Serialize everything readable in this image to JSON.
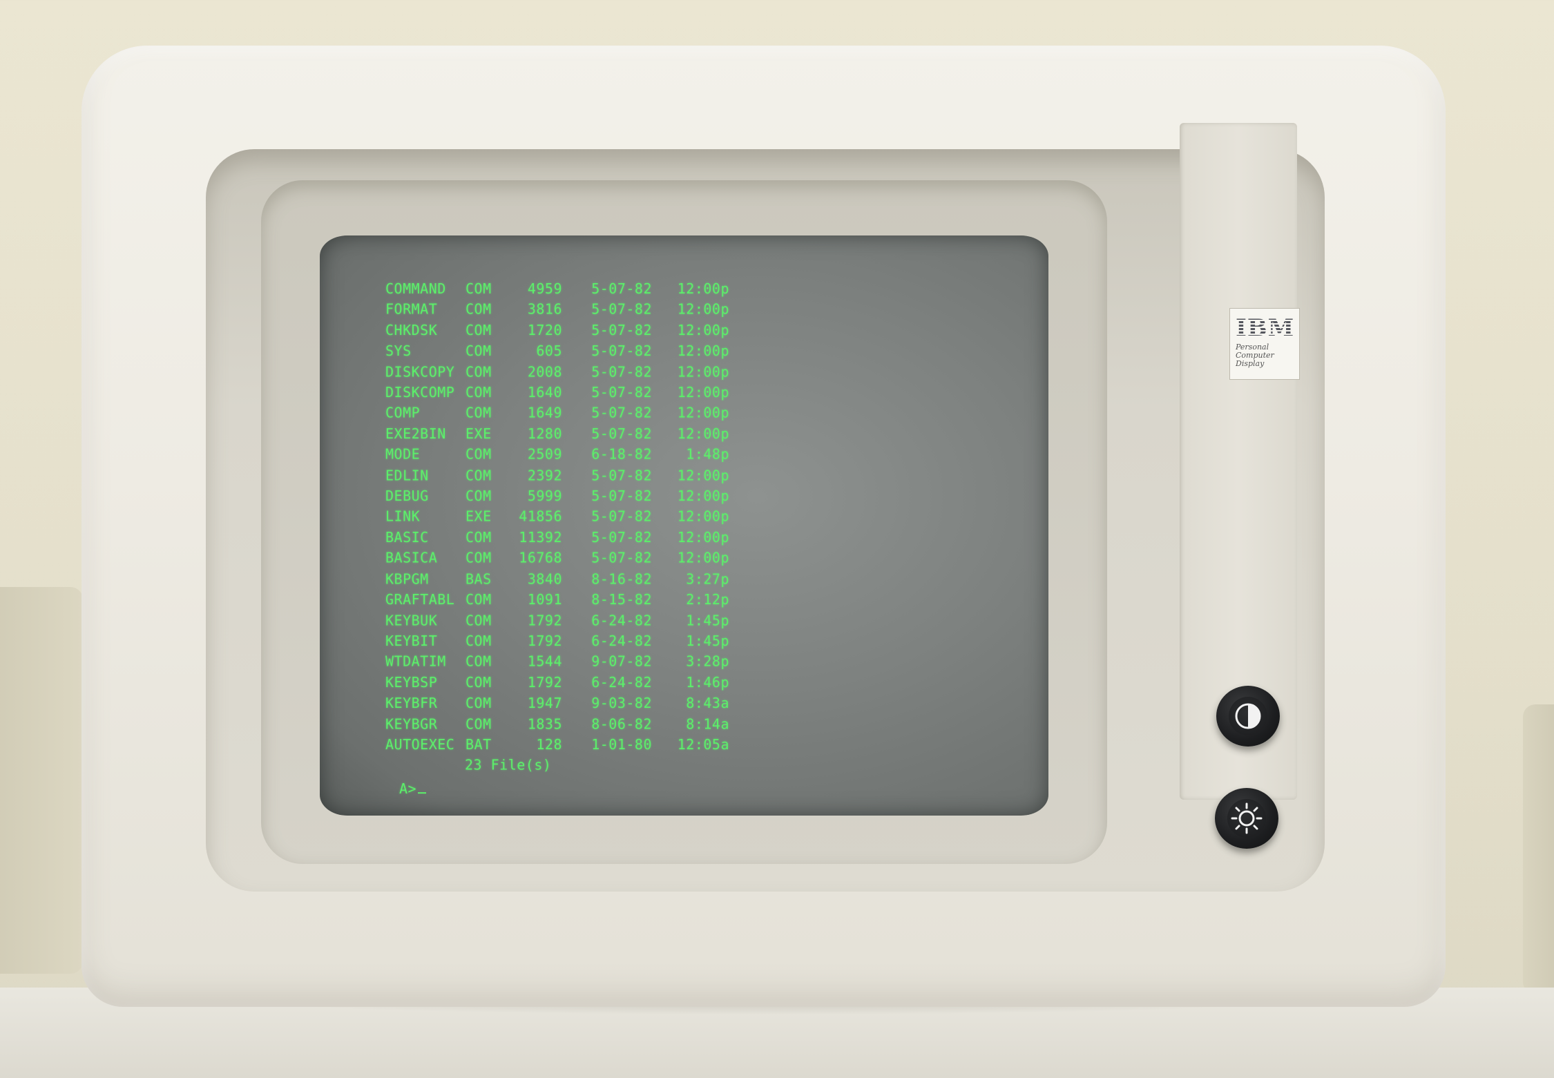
{
  "directory_listing": {
    "rows": [
      {
        "name": "COMMAND",
        "ext": "COM",
        "size": "4959",
        "date": "5-07-82",
        "time": "12:00p"
      },
      {
        "name": "FORMAT",
        "ext": "COM",
        "size": "3816",
        "date": "5-07-82",
        "time": "12:00p"
      },
      {
        "name": "CHKDSK",
        "ext": "COM",
        "size": "1720",
        "date": "5-07-82",
        "time": "12:00p"
      },
      {
        "name": "SYS",
        "ext": "COM",
        "size": "605",
        "date": "5-07-82",
        "time": "12:00p"
      },
      {
        "name": "DISKCOPY",
        "ext": "COM",
        "size": "2008",
        "date": "5-07-82",
        "time": "12:00p"
      },
      {
        "name": "DISKCOMP",
        "ext": "COM",
        "size": "1640",
        "date": "5-07-82",
        "time": "12:00p"
      },
      {
        "name": "COMP",
        "ext": "COM",
        "size": "1649",
        "date": "5-07-82",
        "time": "12:00p"
      },
      {
        "name": "EXE2BIN",
        "ext": "EXE",
        "size": "1280",
        "date": "5-07-82",
        "time": "12:00p"
      },
      {
        "name": "MODE",
        "ext": "COM",
        "size": "2509",
        "date": "6-18-82",
        "time": "1:48p"
      },
      {
        "name": "EDLIN",
        "ext": "COM",
        "size": "2392",
        "date": "5-07-82",
        "time": "12:00p"
      },
      {
        "name": "DEBUG",
        "ext": "COM",
        "size": "5999",
        "date": "5-07-82",
        "time": "12:00p"
      },
      {
        "name": "LINK",
        "ext": "EXE",
        "size": "41856",
        "date": "5-07-82",
        "time": "12:00p"
      },
      {
        "name": "BASIC",
        "ext": "COM",
        "size": "11392",
        "date": "5-07-82",
        "time": "12:00p"
      },
      {
        "name": "BASICA",
        "ext": "COM",
        "size": "16768",
        "date": "5-07-82",
        "time": "12:00p"
      },
      {
        "name": "KBPGM",
        "ext": "BAS",
        "size": "3840",
        "date": "8-16-82",
        "time": "3:27p"
      },
      {
        "name": "GRAFTABL",
        "ext": "COM",
        "size": "1091",
        "date": "8-15-82",
        "time": "2:12p"
      },
      {
        "name": "KEYBUK",
        "ext": "COM",
        "size": "1792",
        "date": "6-24-82",
        "time": "1:45p"
      },
      {
        "name": "KEYBIT",
        "ext": "COM",
        "size": "1792",
        "date": "6-24-82",
        "time": "1:45p"
      },
      {
        "name": "WTDATIM",
        "ext": "COM",
        "size": "1544",
        "date": "9-07-82",
        "time": "3:28p"
      },
      {
        "name": "KEYBSP",
        "ext": "COM",
        "size": "1792",
        "date": "6-24-82",
        "time": "1:46p"
      },
      {
        "name": "KEYBFR",
        "ext": "COM",
        "size": "1947",
        "date": "9-03-82",
        "time": "8:43a"
      },
      {
        "name": "KEYBGR",
        "ext": "COM",
        "size": "1835",
        "date": "8-06-82",
        "time": "8:14a"
      },
      {
        "name": "AUTOEXEC",
        "ext": "BAT",
        "size": "128",
        "date": "1-01-80",
        "time": "12:05a"
      }
    ],
    "summary": "23 File(s)",
    "prompt": "A>"
  },
  "badge": {
    "brand": "IBM",
    "line1": "Personal",
    "line2": "Computer",
    "line3": "Display"
  },
  "controls": {
    "contrast_icon": "contrast-icon",
    "brightness_icon": "brightness-icon"
  },
  "colors": {
    "phosphor": "#5cf06a",
    "screen": "#7d817f",
    "case": "#eeebe3"
  }
}
